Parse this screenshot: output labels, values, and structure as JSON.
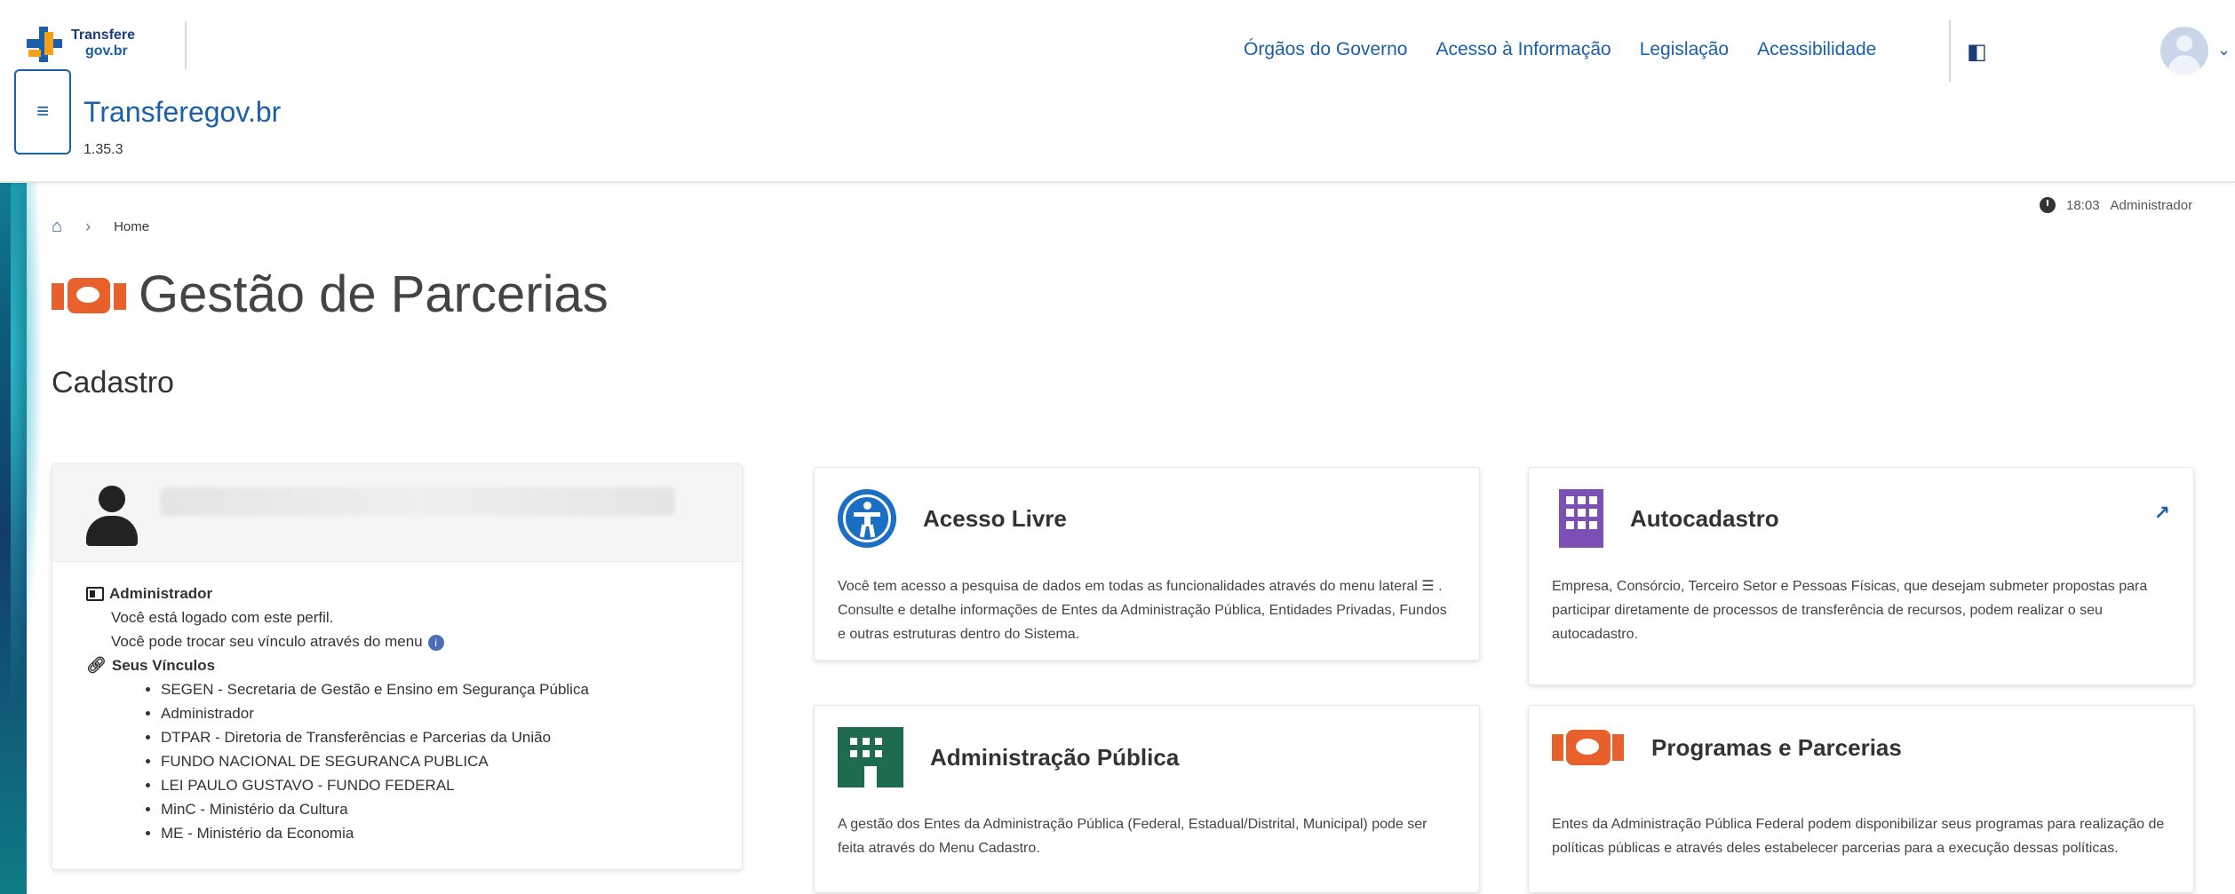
{
  "header": {
    "logo_line1": "Transfere",
    "logo_line2": "gov.br",
    "system_name": "Transferegov.br",
    "version": "1.35.3",
    "links": [
      "Órgãos do Governo",
      "Acesso à Informação",
      "Legislação",
      "Acessibilidade"
    ],
    "icons": {
      "menu": "hamburger-menu-icon",
      "contrast": "contrast-icon",
      "avatar": "user-avatar-icon",
      "caret": "chevron-down-icon"
    }
  },
  "breadcrumb": {
    "home_icon": "home-icon",
    "separator": "›",
    "current": "Home"
  },
  "status": {
    "time": "18:03",
    "profile": "Administrador"
  },
  "page": {
    "title": "Gestão de Parcerias",
    "section": "Cadastro"
  },
  "profile_card": {
    "role_label": "Administrador",
    "logged_text": "Você está logado com este perfil.",
    "switch_text": "Você pode trocar seu vínculo através do menu",
    "vinculos_label": "Seus Vínculos",
    "vinculos": [
      "SEGEN - Secretaria de Gestão e Ensino em Segurança Pública",
      "Administrador",
      "DTPAR - Diretoria de Transferências e Parcerias da União",
      "FUNDO NACIONAL DE SEGURANCA PUBLICA",
      "LEI PAULO GUSTAVO - FUNDO FEDERAL",
      "MinC - Ministério da Cultura",
      "ME - Ministério da Economia"
    ]
  },
  "cards": {
    "acesso_livre": {
      "title": "Acesso Livre",
      "description": "Você tem acesso a pesquisa de dados em todas as funcionalidades através do menu lateral ☰ . Consulte e detalhe informações de Entes da Administração Pública, Entidades Privadas, Fundos e outras estruturas dentro do Sistema."
    },
    "autocadastro": {
      "title": "Autocadastro",
      "description": "Empresa, Consórcio, Terceiro Setor e Pessoas Físicas, que desejam submeter propostas para participar diretamente de processos de transferência de recursos, podem realizar o seu autocadastro."
    },
    "administracao_publica": {
      "title": "Administração Pública",
      "description": "A gestão dos Entes da Administração Pública (Federal, Estadual/Distrital, Municipal) pode ser feita através do Menu Cadastro."
    },
    "programas_parcerias": {
      "title": "Programas e Parcerias",
      "description": "Entes da Administração Pública Federal podem disponibilizar seus programas para realização de políticas públicas e através deles estabelecer parcerias para a execução dessas políticas."
    }
  },
  "colors": {
    "brand_blue": "#1a5fa8",
    "accent_orange": "#e8612c",
    "purple": "#7b4fb3",
    "green": "#1e6b4d"
  }
}
